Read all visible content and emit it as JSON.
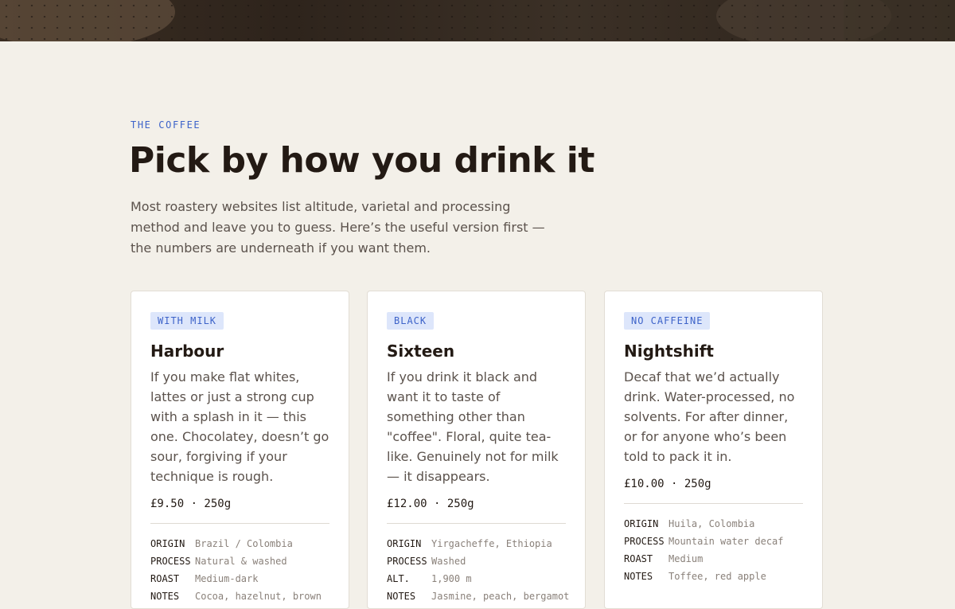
{
  "section": {
    "eyebrow": "THE COFFEE",
    "title": "Pick by how you drink it",
    "lede": "Most roastery websites list altitude, varietal and processing method and leave you to guess. Here’s the useful version first — the numbers are underneath if you want them."
  },
  "cards": [
    {
      "tag": "WITH MILK",
      "name": "Harbour",
      "description": "If you make flat whites, lattes or just a strong cup with a splash in it — this one. Chocolatey, doesn’t go sour, forgiving if your technique is rough.",
      "price": "£9.50 · 250g",
      "specs": [
        {
          "label": "ORIGIN",
          "value": "Brazil / Colombia"
        },
        {
          "label": "PROCESS",
          "value": "Natural & washed"
        },
        {
          "label": "ROAST",
          "value": "Medium-dark"
        },
        {
          "label": "NOTES",
          "value": "Cocoa, hazelnut, brown"
        }
      ]
    },
    {
      "tag": "BLACK",
      "name": "Sixteen",
      "description": "If you drink it black and want it to taste of something other than \"coffee\". Floral, quite tea-like. Genuinely not for milk — it disappears.",
      "price": "£12.00 · 250g",
      "specs": [
        {
          "label": "ORIGIN",
          "value": "Yirgacheffe, Ethiopia"
        },
        {
          "label": "PROCESS",
          "value": "Washed"
        },
        {
          "label": "ALT.",
          "value": "1,900 m"
        },
        {
          "label": "NOTES",
          "value": "Jasmine, peach, bergamot"
        }
      ]
    },
    {
      "tag": "NO CAFFEINE",
      "name": "Nightshift",
      "description": "Decaf that we’d actually drink. Water-processed, no solvents. For after dinner, or for anyone who’s been told to pack it in.",
      "price": "£10.00 · 250g",
      "specs": [
        {
          "label": "ORIGIN",
          "value": "Huila, Colombia"
        },
        {
          "label": "PROCESS",
          "value": "Mountain water decaf"
        },
        {
          "label": "ROAST",
          "value": "Medium"
        },
        {
          "label": "NOTES",
          "value": "Toffee, red apple"
        }
      ]
    }
  ],
  "colors": {
    "background": "#f3f0e9",
    "accent": "#3d63c9",
    "tag_background": "#dde6fb",
    "text": "#231a14",
    "muted": "#5b524c"
  }
}
